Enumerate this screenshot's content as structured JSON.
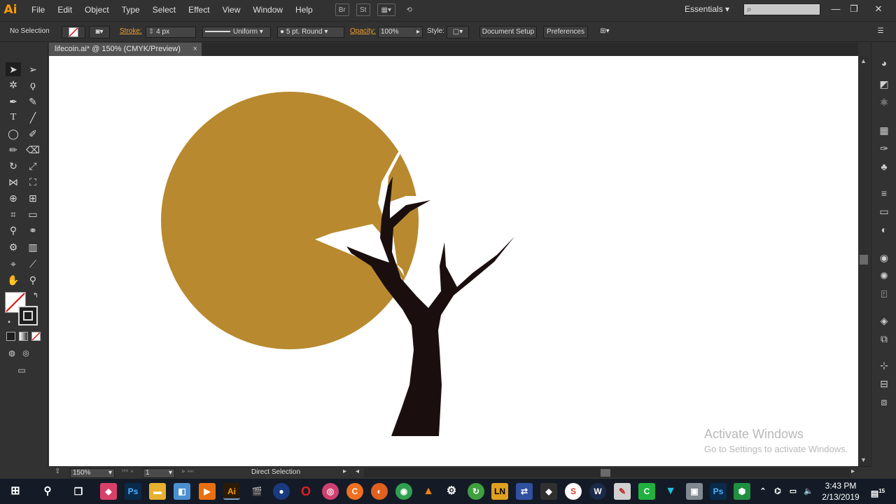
{
  "app": {
    "logo": "Ai"
  },
  "menu": [
    "File",
    "Edit",
    "Object",
    "Type",
    "Select",
    "Effect",
    "View",
    "Window",
    "Help"
  ],
  "menubar": {
    "bridge_icon": "Br",
    "stock_icon": "St",
    "workspace": "Essentials"
  },
  "controlbar": {
    "selection": "No Selection",
    "stroke_label": "Stroke:",
    "stroke_value": "4 px",
    "profile": "Uniform",
    "brush": "5 pt. Round",
    "opacity_label": "Opacity:",
    "opacity_value": "100%",
    "style_label": "Style:",
    "document_setup": "Document Setup",
    "preferences": "Preferences"
  },
  "document": {
    "tab_title": "lifecoin.ai* @ 150% (CMYK/Preview)",
    "close": "×"
  },
  "artwork": {
    "circle_color": "#b8892e",
    "trunk_color": "#1a0f0e"
  },
  "watermark": {
    "line1": "Activate Windows",
    "line2": "Go to Settings to activate Windows."
  },
  "statusbar": {
    "zoom": "150%",
    "artboard": "1",
    "tool": "Direct Selection"
  },
  "taskbar": {
    "time": "3:43 PM",
    "date": "2/13/2019",
    "notifications": "15"
  },
  "colors": {
    "accent": "#ff9a00",
    "panel": "#323232",
    "canvas": "#ffffff"
  }
}
